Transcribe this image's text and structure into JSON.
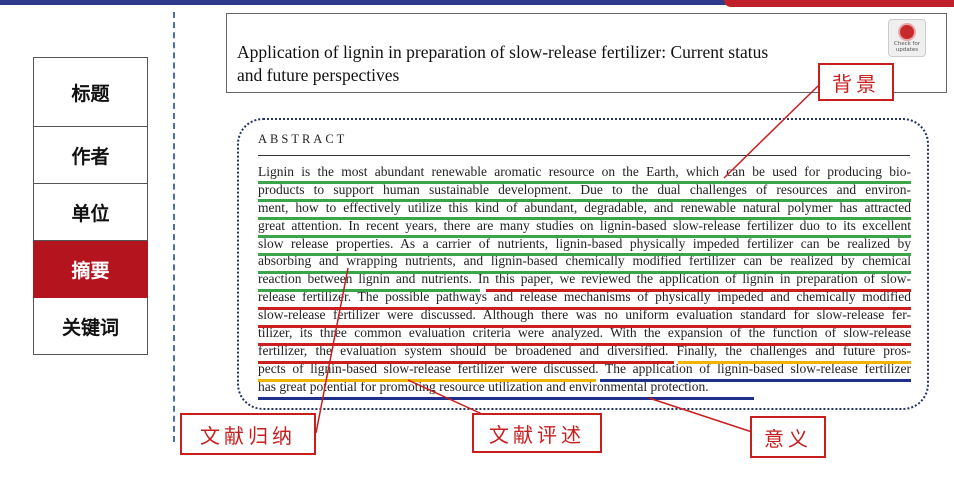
{
  "nav": {
    "items": [
      {
        "label": "标题"
      },
      {
        "label": "作者"
      },
      {
        "label": "单位"
      },
      {
        "label": "摘要",
        "active": true
      },
      {
        "label": "关键词"
      }
    ]
  },
  "paper": {
    "title_line1": "Application of lignin in preparation of slow-release fertilizer: Current status",
    "title_line2": "and future perspectives",
    "badge_line1": "Check for",
    "badge_line2": "updates",
    "abstract_heading": "ABSTRACT",
    "abstract_lines": [
      "Lignin is the most abundant renewable aromatic resource on the Earth, which can be used for producing bio-",
      "products to support human sustainable development. Due to the dual challenges of resources and environ-",
      "ment, how to effectively utilize this kind of abundant, degradable, and renewable natural polymer has attracted",
      "great attention. In recent years, there are many studies on lignin-based slow-release fertilizer duo to its excellent",
      "slow release properties. As a carrier of nutrients, lignin-based physically impeded fertilizer can be realized by",
      "absorbing and wrapping nutrients, and lignin-based chemically modified fertilizer can be realized by chemical",
      "reaction between lignin and nutrients. In this paper, we reviewed the application of lignin in preparation of slow-",
      "release fertilizer. The possible pathways and release mechanisms of physically impeded and chemically modified",
      "slow-release fertilizer were discussed. Although there was no uniform evaluation standard for slow-release fer-",
      "tilizer, its three common evaluation criteria were analyzed. With the expansion of the function of slow-release",
      "fertilizer, the evaluation system should be broadened and diversified. Finally, the challenges and future pros-",
      "pects of lignin-based slow-release fertilizer were discussed. The application of lignin-based slow-release fertilizer",
      "has great potential for promoting resource utilization and environmental protection."
    ]
  },
  "callouts": {
    "background": "背景",
    "literature_summary": "文献归纳",
    "literature_review": "文献评述",
    "significance": "意义"
  },
  "colors": {
    "accent_red": "#c81e1e",
    "active_nav": "#b4141e",
    "underline_green": "#3aa54a",
    "underline_red": "#cc2020",
    "underline_yellow": "#f0b400",
    "underline_blue": "#1f2f8c",
    "top_bar": "#2e3a8c"
  }
}
